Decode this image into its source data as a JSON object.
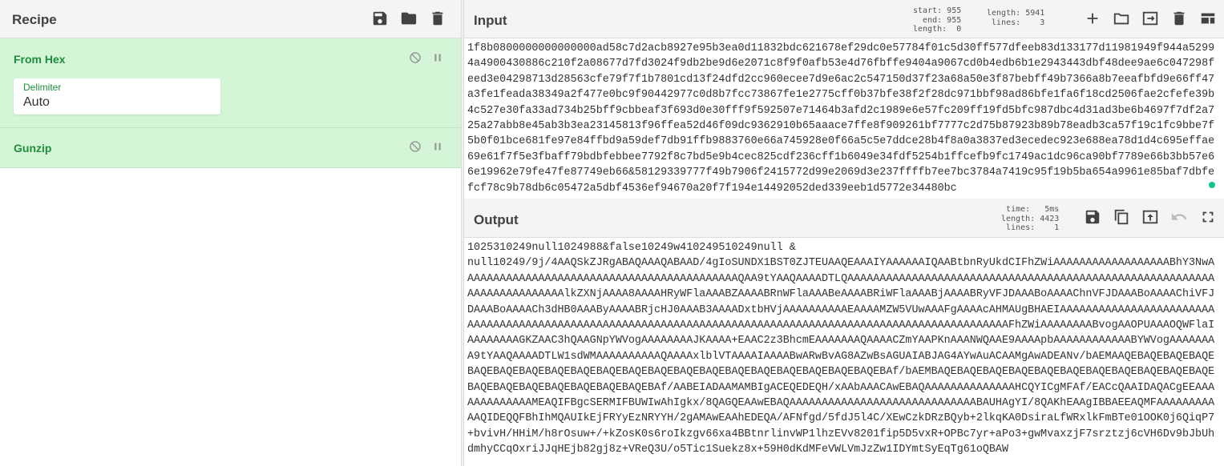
{
  "recipe": {
    "title": "Recipe",
    "buttons": [
      {
        "name": "save-icon"
      },
      {
        "name": "folder-icon"
      },
      {
        "name": "trash-icon"
      }
    ],
    "operations": [
      {
        "name": "From Hex",
        "args": [
          {
            "label": "Delimiter",
            "value": "Auto"
          }
        ]
      },
      {
        "name": "Gunzip",
        "args": []
      }
    ]
  },
  "input": {
    "title": "Input",
    "stats": {
      "start_label": "start:",
      "start": "955",
      "end_label": "end:",
      "end": "955",
      "sel_length_label": "length:",
      "sel_length": "0",
      "length_label": "length:",
      "length": "5941",
      "lines_label": "lines:",
      "lines": "3"
    },
    "text": "1f8b0800000000000000ad58c7d2acb8927e95b3ea0d11832bdc621678ef29dc0e57784f01c5d30ff577dfeeb83d133177d11981949f944a52994a4900430886c210f2a08677d7fd3024f9db2be9d6e2071c8f9f0afb53e4d76fbffe9404a9067cd0b4edb6b1e2943443dbf48dee9ae6c047298feed3e04298713d28563cfe79f7f1b7801cd13f24dfd2cc960ecee7d9e6ac2c547150d37f23a68a50e3f87bebff49b7366a8b7eeafbfd9e66ff47a3fe1feada38349a2f477e0bc9f90442977c0d8b7fcc73867fe1e2775cff0b37bfe38f2f28dc971bbf98ad86bfe1fa6f18cd2506fae2cfefe39b4c527e30fa33ad734b25bff9cbbeaf3f693d0e30fff9f592507e71464b3afd2c1989e6e57fc209ff19fd5bfc987dbc4d31ad3be6b4697f7df2a725a27abb8e45ab3b3ea23145813f96ffea52d46f09dc9362910b65aaace7ffe8f909261bf7777c2d75b87923b89b78eadb3ca57f19c1fc9bbe7f5b0f01bce681fe97e84ffbd9a59def7db91ffb9883760e66a745928e0f66a5c5e7ddce28b4f8a0a3837ed3ecedec923e688ea78d1d4c695effae69e61f7f5e3fbaff79bdbfebbee7792f8c7bd5e9b4cec825cdf236cff1b6049e34fdf5254b1ffcefb9fc1749ac1dc96ca90bf7789e66b3bb57e66e19962e79fe47fe87749eb66&58129339777f49b7906f2415772d99e2069d3e237ffffb7ee7bc3784a7419c95f19b5ba654a9961e85baf7dbfefcf78c9b78db6c05472a5dbf4536ef94670a20f7f194e14492052ded339eeb1d5772e34480bc"
  },
  "output": {
    "title": "Output",
    "stats": {
      "time_label": "time:",
      "time": "5ms",
      "length_label": "length:",
      "length": "4423",
      "lines_label": "lines:",
      "lines": "1"
    },
    "text": "1025310249null1024988&false10249w410249510249null &\nnull10249/9j/4AAQSkZJRgABAQAAAQABAAD/4gIoSUNDX1BST0ZJTEUAAQEAAAIYAAAAAAIQAABtbnRyUkdCIFhZWiAAAAAAAAAAAAAAAAAABhY3NwAAAAAAAAAAAAAAAAAAAAAAAAAAAAAAAAAAAAAAAAAAAQAA9tYAAQAAAADTLQAAAAAAAAAAAAAAAAAAAAAAAAAAAAAAAAAAAAAAAAAAAAAAAAAAAAAAAAAAAAAAAAAAAAAAAAlkZXNjAAAA8AAAAHRyWFlaAAABZAAAABRnWFlaAAABeAAAABRiWFlaAAABjAAAABRyVFJDAAABoAAAAChnVFJDAAABoAAAAChiVFJDAAABoAAAACh3dHB0AAAByAAAABRjcHJ0AAAB3AAAADxtbHVjAAAAAAAAAAEAAAAMZW5VUwAAAFgAAAAcAHMAUgBHAEIAAAAAAAAAAAAAAAAAAAAAAAAAAAAAAAAAAAAAAAAAAAAAAAAAAAAAAAAAAAAAAAAAAAAAAAAAAAAAAAAAAAAAAAAAAAAAAAAAAAAAAAAAAAAFhZWiAAAAAAAABvogAAOPUAAAOQWFlaIAAAAAAAAGKZAAC3hQAAGNpYWVogAAAAAAAAJKAAAA+EAAC2z3BhcmEAAAAAAAQAAAACZmYAAPKnAAANWQAAE9AAAApbAAAAAAAAAAAABYWVogAAAAAAAA9tYAAQAAAADTLW1sdWMAAAAAAAAAAQAAAAxlblVTAAAAIAAAABwARwBvAG8AZwBsAGUAIABJAG4AYwAuACAAMgAwADEANv/bAEMAAQEBAQEBAQEBAQEBAQEBAQEBAQEBAQEBAQEBAQEBAQEBAQEBAQEBAQEBAQEBAQEBAQEBAQEBAQEBAQEBAf/bAEMBAQEBAQEBAQEBAQEBAQEBAQEBAQEBAQEBAQEBAQEBAQEBAQEBAQEBAQEBAQEBAQEBAQEBAQEBAf/AABEIADAAMAMBIgACEQEDEQH/xAAbAAACAwEBAQAAAAAAAAAAAAAAHCQYICgMFAf/EACcQAAIDAQACgEEAAAAAAAAAAAAAMEAQIFBgcSERMIFBUWIwAhIgkx/8QAGQEAAwEBAQAAAAAAAAAAAAAAAAAAAAAAAAAAAAABAUHAgYI/8QAKhEAAgIBBAEEAQMFAAAAAAAAAAAQIDEQQFBhIhMQAUIkEjFRYyEzNRYYH/2gAMAwEAAhEDEQA/AFNfgd/5fdJ5l4C/XEwCzkDRzBQyb+2lkqKA0DsiraLfWRxlkFmBTe01OOK0j6QiqP7+bvivH/HHiM/h8rOsuw+/+kZosK0s6roIkzgv66xa4BBtnrlinvWP1lhzEVv8201fip5D5vxR+OPBc7yr+aPo3+gwMvaxzjF7srztzj6cVH6Dv9bJbUhdmhyCCqOxriJJqHEjb82gj8z+VReQ3U/o5Tic1Suekz8x+59H0dKdMFeVWLVmJzZw1IDYmtSyEqTg61oQBAW"
  }
}
